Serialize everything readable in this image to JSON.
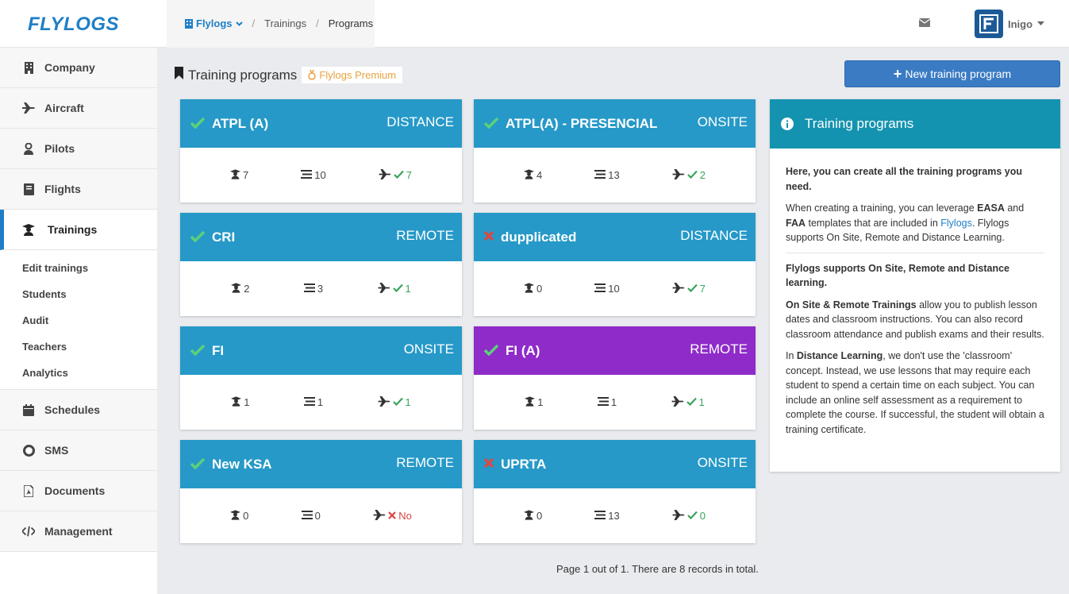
{
  "brand": {
    "logo_text": "FLYLOGS",
    "color": "#1e7fc7"
  },
  "nav": {
    "items": [
      {
        "label": "Company",
        "icon": "building-icon"
      },
      {
        "label": "Aircraft",
        "icon": "plane-icon"
      },
      {
        "label": "Pilots",
        "icon": "pilot-icon"
      },
      {
        "label": "Flights",
        "icon": "logbook-icon"
      },
      {
        "label": "Trainings",
        "icon": "graduation-icon"
      }
    ],
    "sub_items": [
      "Edit trainings",
      "Students",
      "Audit",
      "Teachers",
      "Analytics"
    ],
    "bottom_items": [
      {
        "label": "Schedules",
        "icon": "calendar-icon"
      },
      {
        "label": "SMS",
        "icon": "lifebuoy-icon"
      },
      {
        "label": "Documents",
        "icon": "pdf-icon"
      },
      {
        "label": "Management",
        "icon": "code-icon"
      }
    ]
  },
  "breadcrumb": {
    "root": "Flylogs",
    "level2": "Trainings",
    "level3": "Programs"
  },
  "user": {
    "name": "Inigo"
  },
  "page": {
    "title": "Training programs",
    "badge": "Flylogs Premium",
    "new_button": "New training program"
  },
  "programs": [
    {
      "name": "ATPL (A)",
      "mode": "DISTANCE",
      "active": true,
      "students": "7",
      "lessons": "10",
      "flights": "7",
      "color": "#2699c8"
    },
    {
      "name": "ATPL(A) - PRESENCIAL",
      "mode": "ONSITE",
      "active": true,
      "students": "4",
      "lessons": "13",
      "flights": "2",
      "color": "#2699c8"
    },
    {
      "name": "CRI",
      "mode": "REMOTE",
      "active": true,
      "students": "2",
      "lessons": "3",
      "flights": "1",
      "color": "#2699c8"
    },
    {
      "name": "dupplicated",
      "mode": "DISTANCE",
      "active": false,
      "students": "0",
      "lessons": "10",
      "flights": "7",
      "color": "#2699c8"
    },
    {
      "name": "FI",
      "mode": "ONSITE",
      "active": true,
      "students": "1",
      "lessons": "1",
      "flights": "1",
      "color": "#2699c8"
    },
    {
      "name": "FI (A)",
      "mode": "REMOTE",
      "active": true,
      "students": "1",
      "lessons": "1",
      "flights": "1",
      "color": "#8e2bc9"
    },
    {
      "name": "New KSA",
      "mode": "REMOTE",
      "active": true,
      "students": "0",
      "lessons": "0",
      "flights": "No",
      "flights_ok": false,
      "color": "#2699c8"
    },
    {
      "name": "UPRTA",
      "mode": "ONSITE",
      "active": false,
      "students": "0",
      "lessons": "13",
      "flights": "0",
      "color": "#2699c8"
    }
  ],
  "info": {
    "title": "Training programs",
    "p1": "Here, you can create all the training programs you need.",
    "p2_a": "When creating a training, you can leverage ",
    "p2_b": "EASA",
    "p2_c": " and ",
    "p2_d": "FAA",
    "p2_e": " templates that are included in ",
    "p2_f": "Flylogs",
    "p2_g": ". Flylogs supports On Site, Remote and Distance Learning.",
    "p3": "Flylogs supports On Site, Remote and Distance learning.",
    "p4_a": "On Site & Remote Trainings",
    "p4_b": " allow you to publish lesson dates and classroom instructions. You can also record classroom attendance and publish exams and their results.",
    "p5_a": "In ",
    "p5_b": "Distance Learning",
    "p5_c": ", we don't use the 'classroom' concept. Instead, we use lessons that may require each student to spend a certain time on each subject. You can include an online self assessment as a requirement to complete the course. If successful, the student will obtain a training certificate."
  },
  "footer": {
    "text": "Page 1 out of 1. There are 8 records in total."
  }
}
